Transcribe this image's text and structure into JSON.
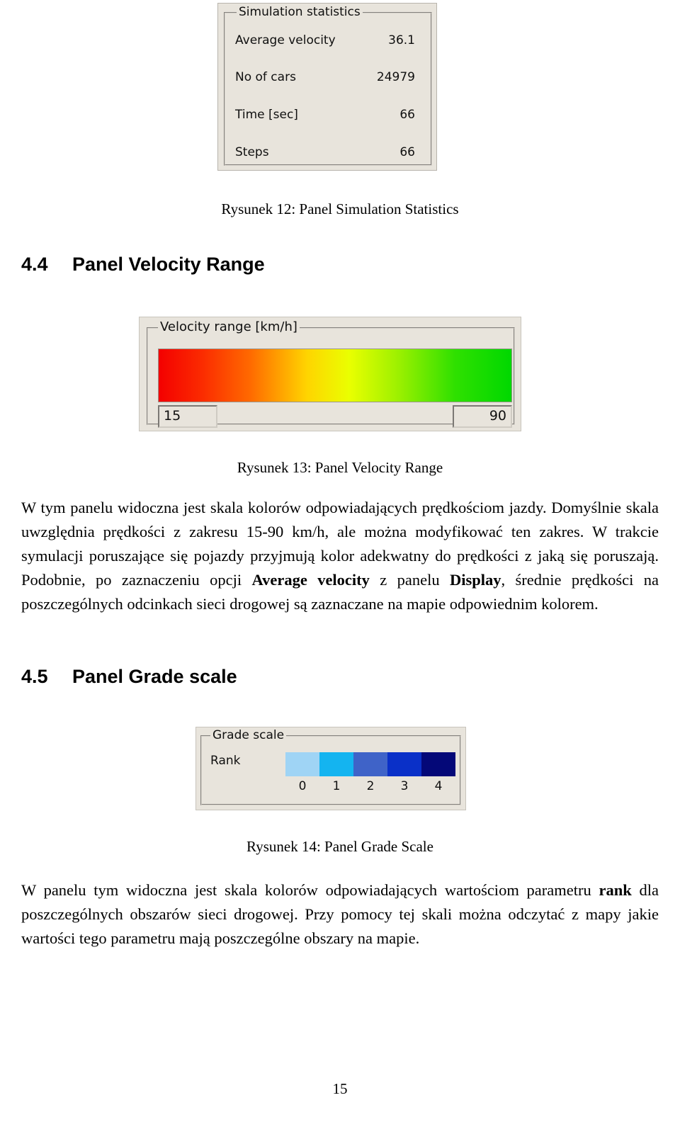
{
  "figure_simulation_statistics": {
    "panel_title": "Simulation statistics",
    "rows": [
      {
        "label": "Average velocity",
        "value": "36.1"
      },
      {
        "label": "No of cars",
        "value": "24979"
      },
      {
        "label": "Time [sec]",
        "value": "66"
      },
      {
        "label": "Steps",
        "value": "66"
      }
    ],
    "caption": "Rysunek 12: Panel Simulation Statistics"
  },
  "section_velocity_range": {
    "number": "4.4",
    "title": "Panel Velocity Range",
    "figure": {
      "panel_title": "Velocity range [km/h]",
      "min_value": "15",
      "max_value": "90",
      "gradient_start_color": "#f40000",
      "gradient_end_color": "#00d800",
      "caption": "Rysunek 13: Panel Velocity Range"
    },
    "paragraph_1": "W tym panelu widoczna jest skala kolorów odpowiadających prędkościom jazdy. Domyślnie skala uwzględnia prędkości z zakresu 15-90 km/h, ale można modyfikować ten zakres. W trakcie symulacji poruszające się pojazdy przyjmują kolor adekwatny do prędkości z jaką się poruszają. Podobnie, po zaznaczeniu opcji ",
    "bold_1": "Average velocity",
    "paragraph_2": " z panelu ",
    "bold_2": "Display",
    "paragraph_3": ", średnie prędkości na poszczególnych odcinkach sieci drogowej są zaznaczane na mapie odpowiednim kolorem."
  },
  "section_grade_scale": {
    "number": "4.5",
    "title": "Panel Grade scale",
    "figure": {
      "panel_title": "Grade scale",
      "rank_label": "Rank",
      "swatch_colors": [
        "#9fd4f5",
        "#14b4f0",
        "#3f63c8",
        "#0a30c8",
        "#040878"
      ],
      "ticks": [
        "0",
        "1",
        "2",
        "3",
        "4"
      ],
      "caption": "Rysunek 14: Panel Grade Scale"
    },
    "paragraph_1": "W panelu tym widoczna jest skala kolorów odpowiadających wartościom parametru ",
    "bold_1": "rank",
    "paragraph_2": " dla poszczególnych obszarów sieci drogowej. Przy pomocy tej skali można odczytać z mapy jakie wartości tego parametru mają poszczególne obszary na mapie."
  },
  "page_number": "15"
}
